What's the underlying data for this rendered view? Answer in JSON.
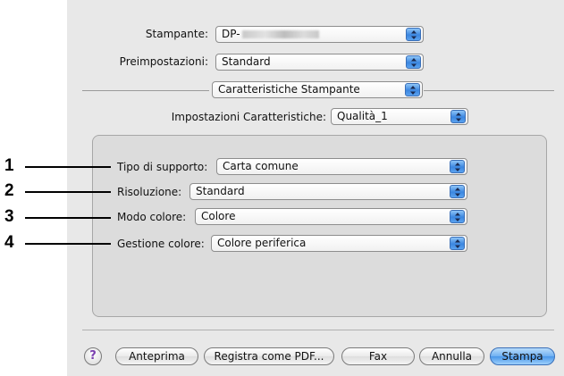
{
  "printer": {
    "label": "Stampante:",
    "value_prefix": "DP-"
  },
  "presets": {
    "label": "Preimpostazioni:",
    "value": "Standard"
  },
  "panel_selector": {
    "value": "Caratteristiche Stampante"
  },
  "feature_set": {
    "label": "Impostazioni Caratteristiche:",
    "value": "Qualità_1"
  },
  "settings": [
    {
      "label": "Tipo di supporto:",
      "value": "Carta comune",
      "callout": "1"
    },
    {
      "label": "Risoluzione:",
      "value": "Standard",
      "callout": "2"
    },
    {
      "label": "Modo colore:",
      "value": "Colore",
      "callout": "3"
    },
    {
      "label": "Gestione colore:",
      "value": "Colore periferica",
      "callout": "4"
    }
  ],
  "buttons": {
    "help": "?",
    "preview": "Anteprima",
    "save_pdf": "Registra come PDF...",
    "fax": "Fax",
    "cancel": "Annulla",
    "print": "Stampa"
  },
  "colors": {
    "accent": "#4a97ea",
    "dialog_bg": "#e8e8e8"
  }
}
